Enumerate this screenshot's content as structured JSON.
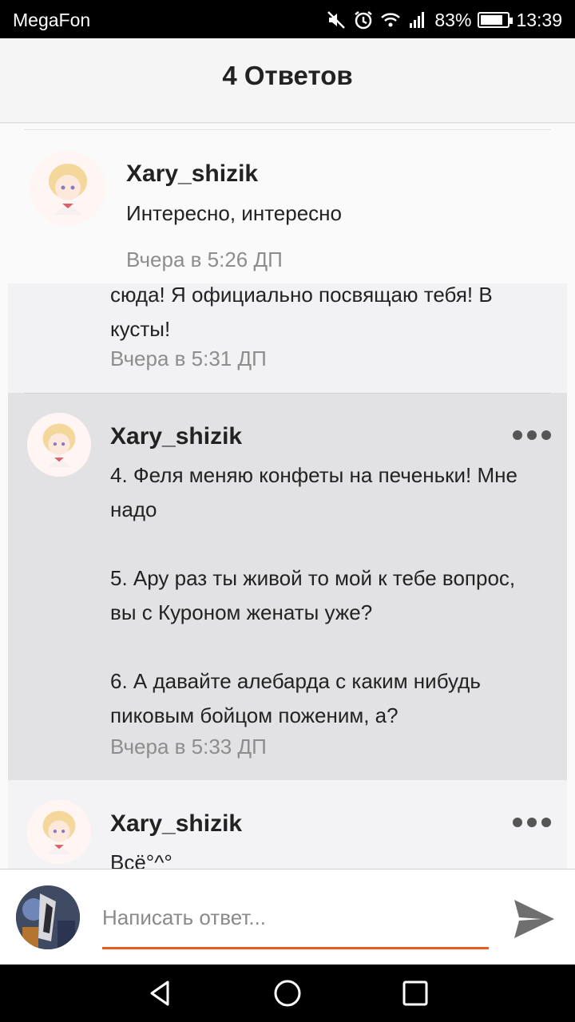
{
  "status_bar": {
    "carrier": "MegaFon",
    "battery_percent": "83%",
    "battery_level": 0.83,
    "time": "13:39",
    "icons": [
      "mute-icon",
      "alarm-icon",
      "wifi-icon",
      "signal-icon",
      "battery-icon"
    ]
  },
  "header": {
    "title": "4 Ответов"
  },
  "comments": [
    {
      "author": "Xary_shizik",
      "text": "Интересно, интересно",
      "time": "Вчера в 5:26 ДП"
    },
    {
      "author": "",
      "text": "сюда! Я официально посвящаю тебя! В кусты!",
      "time": "Вчера в 5:31 ДП"
    },
    {
      "author": "Xary_shizik",
      "paragraphs": [
        "4. Феля меняю конфеты на печеньки! Мне надо",
        "5. Ару раз ты живой то мой к тебе вопрос, вы с Куроном женаты уже?",
        "6. А давайте алебарда с каким нибудь пиковым бойцом поженим, а?"
      ],
      "time": "Вчера в 5:33 ДП"
    },
    {
      "author": "Xary_shizik",
      "text": "Всё°^°"
    }
  ],
  "reply": {
    "placeholder": "Написать ответ..."
  },
  "colors": {
    "accent": "#ec5b1e",
    "highlight_bg": "#e2e2e4",
    "timestamp": "#8d8d8d"
  }
}
